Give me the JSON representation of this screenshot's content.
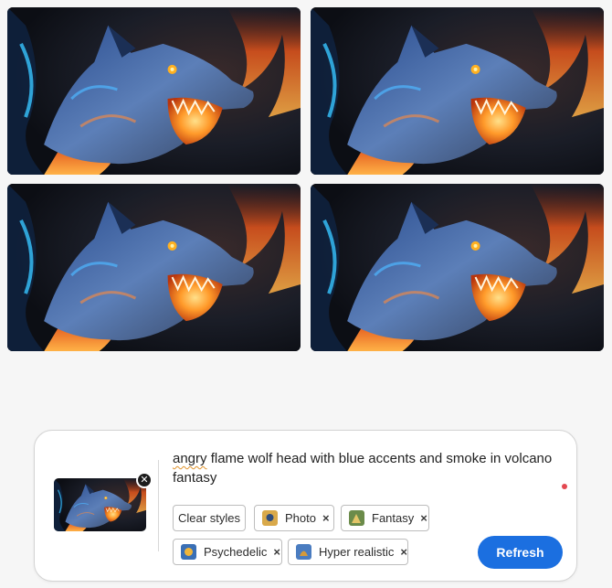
{
  "gallery": {
    "images": [
      {
        "name": "wolf-image-1"
      },
      {
        "name": "wolf-image-2"
      },
      {
        "name": "wolf-image-3"
      },
      {
        "name": "wolf-image-4"
      }
    ]
  },
  "prompt": {
    "misspelled_word": "angry",
    "text_rest": " flame wolf head with blue accents and smoke in volcano fantasy",
    "remove_reference_icon": "close-icon"
  },
  "styles": {
    "clear_label": "Clear styles",
    "chips": [
      {
        "label": "Photo",
        "remove": "×"
      },
      {
        "label": "Fantasy",
        "remove": "×"
      },
      {
        "label": "Psychedelic",
        "remove": "×"
      },
      {
        "label": "Hyper realistic",
        "remove": "×"
      }
    ]
  },
  "actions": {
    "refresh_label": "Refresh"
  },
  "colors": {
    "accent": "#1b6fe0",
    "indicator": "#e34850",
    "spellcheck": "#e0922a"
  }
}
